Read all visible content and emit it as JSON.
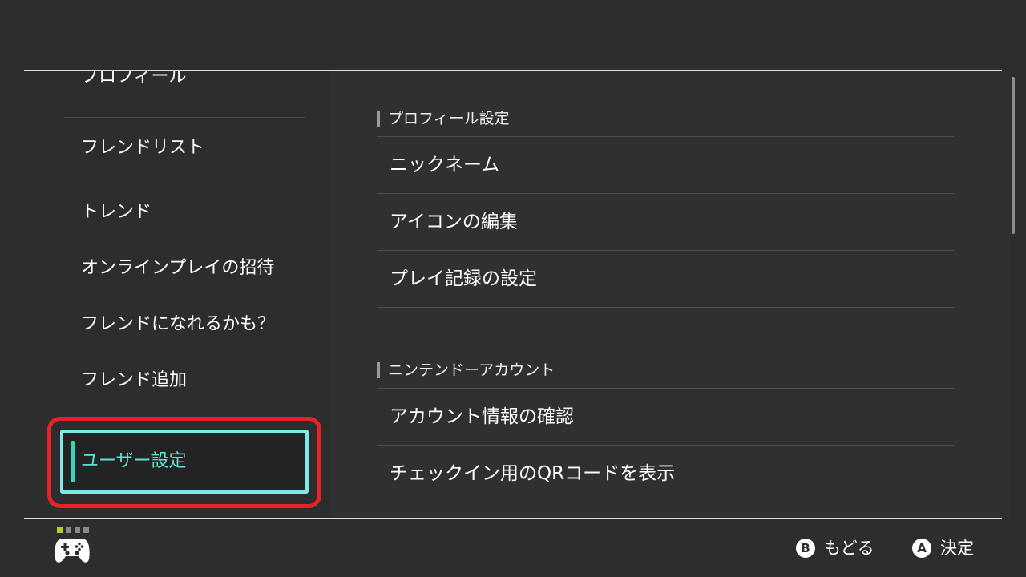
{
  "sidebar": {
    "items": [
      {
        "label": "プロフィール"
      },
      {
        "label": "フレンドリスト"
      },
      {
        "label": "トレンド"
      },
      {
        "label": "オンラインプレイの招待"
      },
      {
        "label": "フレンドになれるかも？"
      },
      {
        "label": "フレンド追加"
      },
      {
        "label": "ユーザー設定",
        "selected": true
      }
    ]
  },
  "main": {
    "sections": [
      {
        "title": "プロフィール設定",
        "items": [
          "ニックネーム",
          "アイコンの編集",
          "プレイ記録の設定"
        ]
      },
      {
        "title": "ニンテンドーアカウント",
        "items": [
          "アカウント情報の確認",
          "チェックイン用のQRコードを表示"
        ]
      }
    ]
  },
  "footer": {
    "hints": [
      {
        "button": "B",
        "label": "もどる"
      },
      {
        "button": "A",
        "label": "決定"
      }
    ],
    "page_dot_colors": [
      "#a8d320",
      "#8a8a8a",
      "#8a8a8a",
      "#8a8a8a"
    ]
  },
  "colors": {
    "background": "#2d2d2d",
    "selection_border": "#7fe8e8",
    "selection_text": "#56e6d2",
    "highlight_ring": "#e8222a"
  }
}
